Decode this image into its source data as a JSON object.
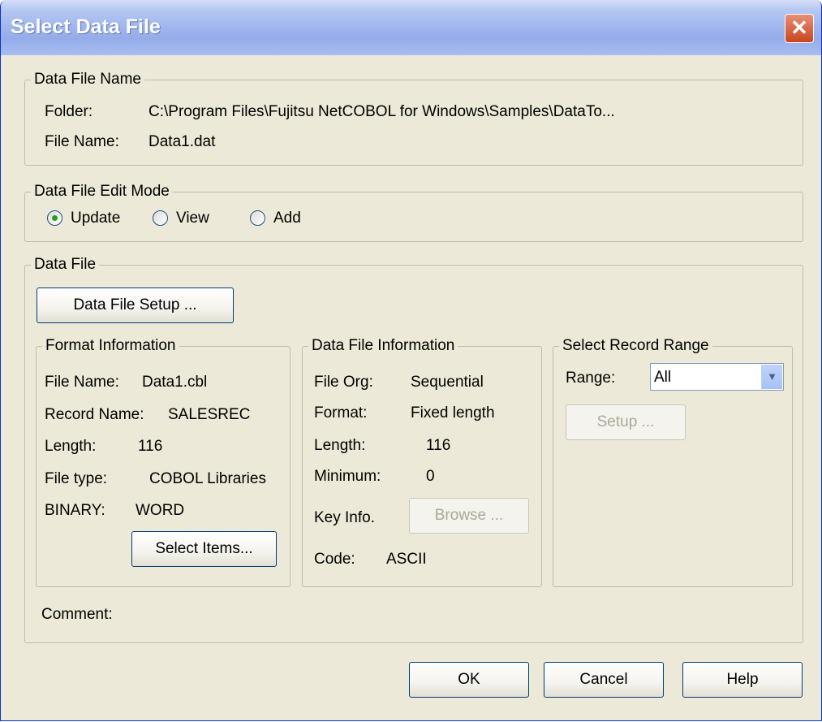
{
  "window": {
    "title": "Select Data File",
    "close_glyph": "✕"
  },
  "data_file_name": {
    "legend": "Data File Name",
    "folder_label": "Folder:",
    "folder_value": "C:\\Program Files\\Fujitsu NetCOBOL for Windows\\Samples\\DataTo...",
    "file_name_label": "File Name:",
    "file_name_value": "Data1.dat"
  },
  "edit_mode": {
    "legend": "Data File Edit Mode",
    "options": [
      {
        "label": "Update",
        "checked": true
      },
      {
        "label": "View",
        "checked": false
      },
      {
        "label": "Add",
        "checked": false
      }
    ]
  },
  "data_file": {
    "legend": "Data File",
    "setup_button": "Data File Setup ...",
    "comment_label": "Comment:"
  },
  "format_info": {
    "legend": "Format Information",
    "file_name_label": "File Name:",
    "file_name_value": "Data1.cbl",
    "record_name_label": "Record Name:",
    "record_name_value": "SALESREC",
    "length_label": "Length:",
    "length_value": "116",
    "file_type_label": "File type:",
    "file_type_value": "COBOL Libraries",
    "binary_label": "BINARY:",
    "binary_value": "WORD",
    "select_items_button": "Select Items..."
  },
  "file_info": {
    "legend": "Data File Information",
    "file_org_label": "File Org:",
    "file_org_value": "Sequential",
    "format_label": "Format:",
    "format_value": "Fixed length",
    "length_label": "Length:",
    "length_value": "116",
    "minimum_label": "Minimum:",
    "minimum_value": "0",
    "key_info_label": "Key Info.",
    "browse_button": "Browse ...",
    "code_label": "Code:",
    "code_value": "ASCII"
  },
  "record_range": {
    "legend": "Select Record Range",
    "range_label": "Range:",
    "range_value": "All",
    "setup_button": "Setup ..."
  },
  "footer": {
    "ok": "OK",
    "cancel": "Cancel",
    "help": "Help"
  },
  "colors": {
    "window_bg": "#ece9d8",
    "title_bar": "#a3b8ee",
    "close_button": "#c8451f",
    "radio_dot": "#21a121",
    "disabled_text": "#aca899"
  }
}
